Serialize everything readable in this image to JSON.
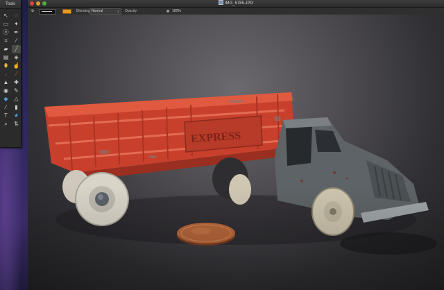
{
  "tools_panel": {
    "title": "Tools",
    "tools": [
      {
        "icon": "arrow-icon",
        "glyph": "↖"
      },
      {
        "icon": "ellipse-select-icon",
        "glyph": "◌"
      },
      {
        "icon": "rect-select-icon",
        "glyph": "▭"
      },
      {
        "icon": "magic-wand-icon",
        "glyph": "✦"
      },
      {
        "icon": "lasso-icon",
        "glyph": "ⓞ"
      },
      {
        "icon": "pen-icon",
        "glyph": "✒"
      },
      {
        "icon": "crop-icon",
        "glyph": "⌗"
      },
      {
        "icon": "eyedropper-icon",
        "glyph": "⁄"
      },
      {
        "icon": "eraser-icon",
        "glyph": "▰"
      },
      {
        "icon": "brush-icon",
        "glyph": "╱"
      },
      {
        "icon": "gradient-icon",
        "glyph": "▤"
      },
      {
        "icon": "fill-bucket-icon",
        "glyph": "◈"
      },
      {
        "icon": "blob-icon",
        "glyph": "⬮"
      },
      {
        "icon": "smudge-icon",
        "glyph": "☝"
      },
      {
        "icon": "paintbrush-icon",
        "glyph": "⸝"
      },
      {
        "icon": "burn-icon",
        "glyph": "⟋"
      },
      {
        "icon": "stamp-icon",
        "glyph": "▲"
      },
      {
        "icon": "heal-icon",
        "glyph": "✚"
      },
      {
        "icon": "eye-icon",
        "glyph": "◉"
      },
      {
        "icon": "pencil-icon",
        "glyph": "✎"
      },
      {
        "icon": "drop-icon",
        "glyph": "◆"
      },
      {
        "icon": "sharpen-icon",
        "glyph": "△"
      },
      {
        "icon": "line-icon",
        "glyph": "∕"
      },
      {
        "icon": "shape-icon",
        "glyph": "▮"
      },
      {
        "icon": "text-icon",
        "glyph": "T"
      },
      {
        "icon": "star-icon",
        "glyph": "★"
      },
      {
        "icon": "zoom-icon",
        "glyph": "⌕"
      },
      {
        "icon": "color-swap-icon",
        "glyph": "⇅"
      }
    ],
    "selected_index": 9
  },
  "window": {
    "title": "IMG_5785.JPG",
    "options": {
      "blending_label": "Blending:",
      "blending_value": "Normal",
      "opacity_label": "Opacity:",
      "opacity_value": "100%",
      "swatch_color": "#e59a1f"
    }
  }
}
